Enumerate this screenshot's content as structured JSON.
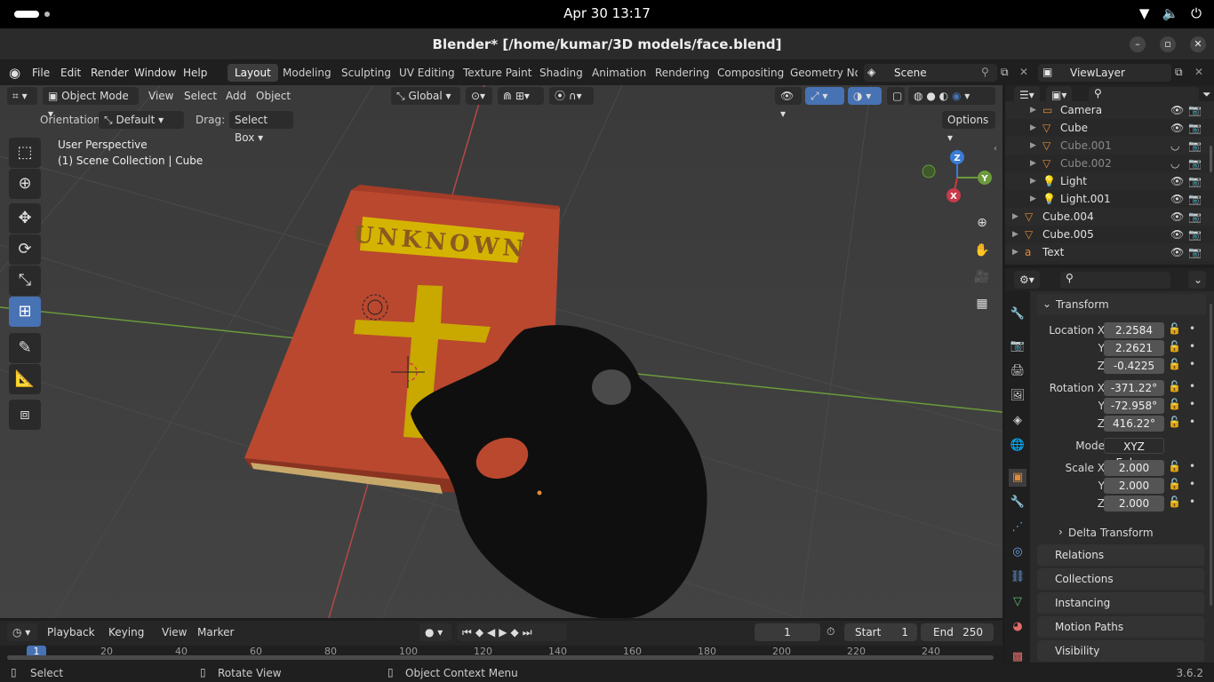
{
  "system": {
    "clock": "Apr 30  13:17"
  },
  "window": {
    "title": "Blender* [/home/kumar/3D models/face.blend]"
  },
  "menu": [
    "File",
    "Edit",
    "Render",
    "Window",
    "Help"
  ],
  "workspaces": [
    "Layout",
    "Modeling",
    "Sculpting",
    "UV Editing",
    "Texture Paint",
    "Shading",
    "Animation",
    "Rendering",
    "Compositing",
    "Geometry Noc"
  ],
  "scene": {
    "name": "Scene",
    "view_layer": "ViewLayer"
  },
  "viewport_header": {
    "mode": "Object Mode",
    "view": "View",
    "select": "Select",
    "add": "Add",
    "object": "Object",
    "transform": "Global"
  },
  "tool_settings": {
    "orientation_label": "Orientation:",
    "orientation": "Default",
    "drag_label": "Drag:",
    "drag": "Select Box",
    "options": "Options"
  },
  "viewport_info": {
    "line1": "User Perspective",
    "line2": "(1) Scene Collection | Cube"
  },
  "book_title": "UNKNOWN",
  "gizmo": {
    "x": "X",
    "y": "Y",
    "z": "Z"
  },
  "outliner": {
    "items": [
      {
        "name": "Camera",
        "dim": false
      },
      {
        "name": "Cube",
        "dim": false
      },
      {
        "name": "Cube.001",
        "dim": true
      },
      {
        "name": "Cube.002",
        "dim": true
      },
      {
        "name": "Light",
        "dim": false
      },
      {
        "name": "Light.001",
        "dim": false
      },
      {
        "name": "Cube.004",
        "dim": false
      },
      {
        "name": "Cube.005",
        "dim": false
      },
      {
        "name": "Text",
        "dim": false
      }
    ]
  },
  "properties": {
    "transform_title": "Transform",
    "location": {
      "label": "Location X",
      "x": "2.2584",
      "y": "2.2621",
      "z": "-0.4225"
    },
    "rotation": {
      "label": "Rotation X",
      "x": "-371.22°",
      "y": "-72.958°",
      "z": "416.22°"
    },
    "mode_label": "Mode",
    "mode": "XYZ Euler",
    "scale": {
      "label": "Scale X",
      "x": "2.000",
      "y": "2.000",
      "z": "2.000"
    },
    "y_label": "Y",
    "z_label": "Z",
    "delta": "Delta Transform",
    "sections": [
      "Relations",
      "Collections",
      "Instancing",
      "Motion Paths",
      "Visibility"
    ]
  },
  "timeline": {
    "playback": "Playback",
    "keying": "Keying",
    "view": "View",
    "marker": "Marker",
    "current_frame": "1",
    "start_label": "Start",
    "start": "1",
    "end_label": "End",
    "end": "250",
    "ticks": [
      "20",
      "40",
      "60",
      "80",
      "100",
      "120",
      "140",
      "160",
      "180",
      "200",
      "220",
      "240"
    ],
    "frame_marker": "1"
  },
  "status": {
    "select": "Select",
    "rotate": "Rotate View",
    "context": "Object Context Menu",
    "version": "3.6.2"
  },
  "colors": {
    "accent": "#4772b3",
    "book": "#b8472e",
    "gold": "#c9a800",
    "object_orange": "#e08b3a"
  }
}
